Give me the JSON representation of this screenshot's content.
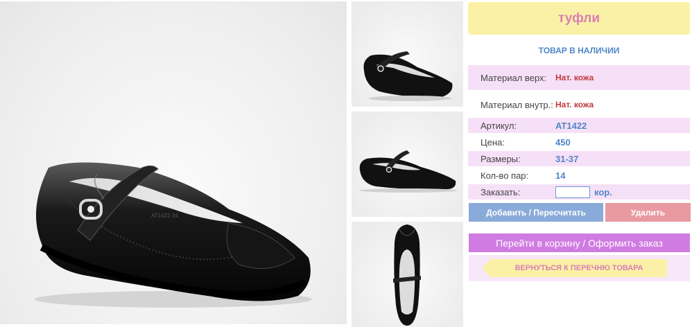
{
  "product": {
    "title": "туфли",
    "stock_status": "ТОВАР В НАЛИЧИИ"
  },
  "details": {
    "material_top_label": "Материал верх:",
    "material_top_value": "Нат. кожа",
    "material_inner_label": "Материал внутр.:",
    "material_inner_value": "Нат. кожа",
    "article_label": "Артикул:",
    "article_value": "AT1422",
    "price_label": "Цена:",
    "price_value": "450",
    "sizes_label": "Размеры:",
    "sizes_value": "31-37",
    "pairs_label": "Кол-во пар:",
    "pairs_value": "14",
    "order_label": "Заказать:",
    "order_value": "",
    "order_unit": "кор."
  },
  "actions": {
    "add_label": "Добавить / Пересчитать",
    "delete_label": "Удалить",
    "cart_label": "Перейти в корзину / Оформить заказ",
    "back_label": "ВЕРНУТЬСЯ К ПЕРЕЧНЮ ТОВАРА"
  },
  "photo": {
    "insole_text": "AT1422  34"
  },
  "colors": {
    "title_bg": "#fbf1a6",
    "title_text": "#d97fb4",
    "accent_blue": "#4f86c6",
    "row_pink": "#f6e0f7",
    "add_button": "#8aabd9",
    "delete_button": "#e89aa0",
    "cart_button": "#d07be2"
  }
}
